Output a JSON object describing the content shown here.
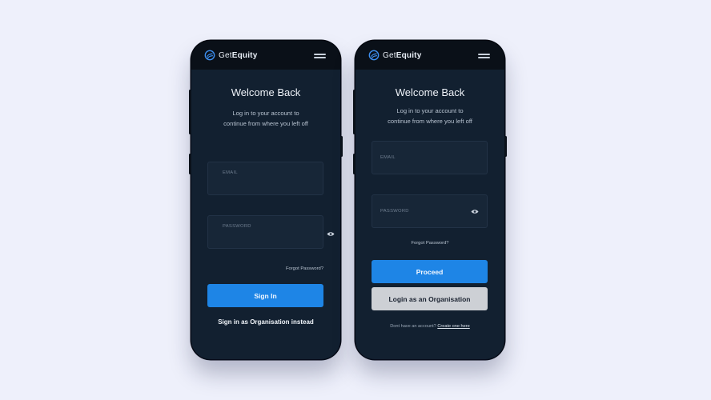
{
  "brand": {
    "prefix": "Get",
    "name": "Equity"
  },
  "left_screen": {
    "title": "Welcome Back",
    "subtitle_line1": "Log in to your account to",
    "subtitle_line2": "continue from where you left off",
    "email_label": "EMAIL",
    "email_value": "",
    "password_label": "PASSWORD",
    "password_value": "",
    "forgot_password": "Forgot Password?",
    "sign_in_button": "Sign In",
    "alt_link": "Sign in as Organisation instead"
  },
  "right_screen": {
    "title": "Welcome Back",
    "subtitle_line1": "Log in to your account to",
    "subtitle_line2": "continue from where you left off",
    "email_label": "EMAIL",
    "email_value": "",
    "password_label": "PASSWORD",
    "password_value": "",
    "forgot_password": "Forgot Password?",
    "proceed_button": "Proceed",
    "organisation_button": "Login as an Organisation",
    "signup_text": "Dont have an account?",
    "signup_link": "Create one here"
  },
  "colors": {
    "background": "#eef0fb",
    "phone_frame": "#0d1621",
    "screen": "#122030",
    "primary_button": "#1e85e6",
    "secondary_button": "#cdd0d5"
  },
  "icons": [
    "logo-icon",
    "hamburger-menu-icon",
    "eye-icon"
  ]
}
